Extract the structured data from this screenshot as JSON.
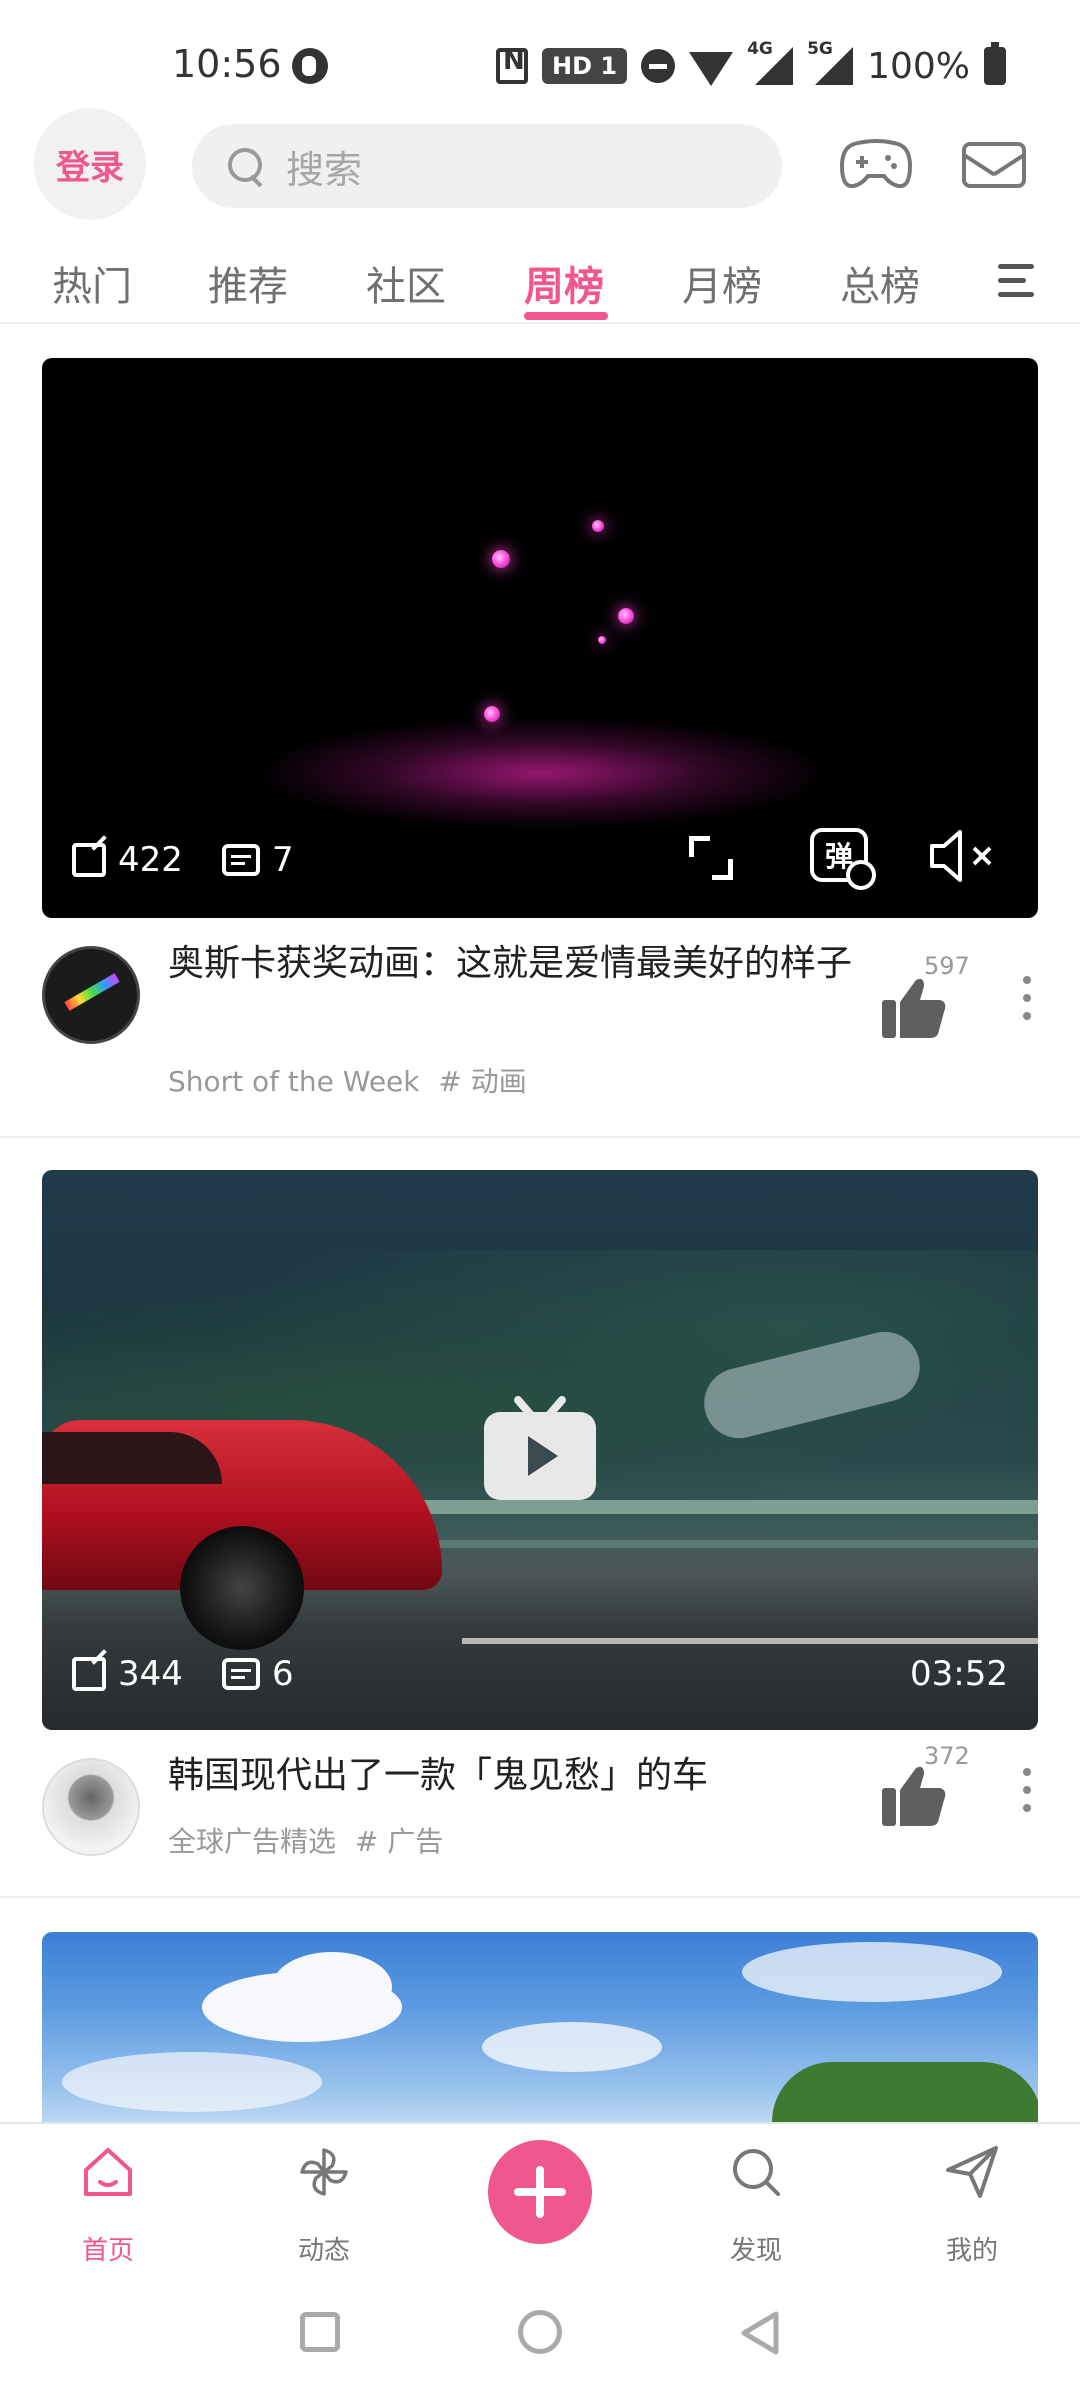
{
  "status_bar": {
    "time": "10:56",
    "hd_label": "HD 1",
    "sig1_label": "4G",
    "sig2_label": "5G",
    "battery": "100%"
  },
  "header": {
    "login_label": "登录",
    "search_placeholder": "搜索",
    "icons": [
      "gamepad-icon",
      "mail-icon"
    ]
  },
  "tabs": {
    "items": [
      {
        "label": "热门",
        "active": false
      },
      {
        "label": "推荐",
        "active": false
      },
      {
        "label": "社区",
        "active": false
      },
      {
        "label": "周榜",
        "active": true
      },
      {
        "label": "月榜",
        "active": false
      },
      {
        "label": "总榜",
        "active": false
      }
    ]
  },
  "feed": [
    {
      "shares": "422",
      "comments": "7",
      "danmaku_label": "弹",
      "title": "奥斯卡获奖动画：这就是爱情最美好的样子",
      "channel": "Short of the Week",
      "tag": "# 动画",
      "likes": "597"
    },
    {
      "shares": "344",
      "comments": "6",
      "duration": "03:52",
      "title": "韩国现代出了一款「鬼见愁」的车",
      "channel": "全球广告精选",
      "tag": "# 广告",
      "likes": "372"
    }
  ],
  "bottom_nav": {
    "items": [
      {
        "label": "首页",
        "icon": "home-icon",
        "active": true
      },
      {
        "label": "动态",
        "icon": "pinwheel-icon",
        "active": false
      },
      {
        "label": "",
        "icon": "plus-icon",
        "active": false
      },
      {
        "label": "发现",
        "icon": "search-icon",
        "active": false
      },
      {
        "label": "我的",
        "icon": "paper-plane-icon",
        "active": false
      }
    ]
  },
  "colors": {
    "accent": "#f0578e",
    "text": "#212121",
    "muted": "#999999"
  }
}
